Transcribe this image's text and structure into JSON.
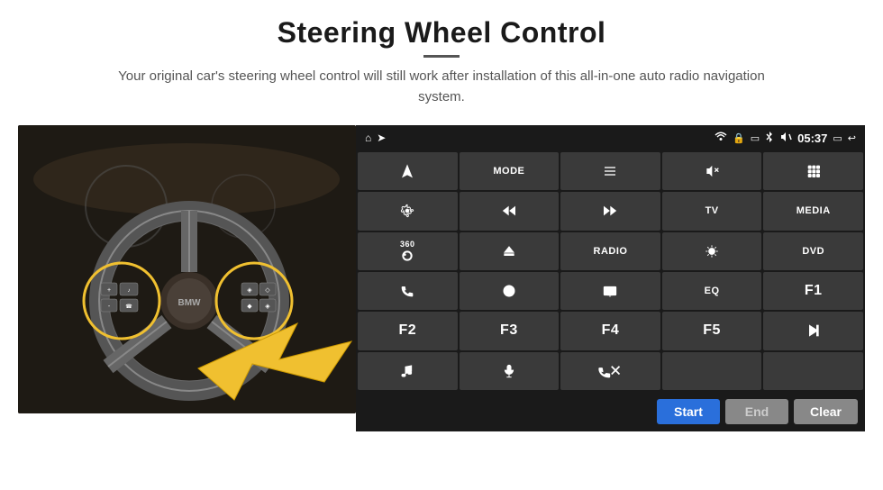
{
  "header": {
    "title": "Steering Wheel Control",
    "subtitle": "Your original car's steering wheel control will still work after installation of this all-in-one auto radio navigation system."
  },
  "statusBar": {
    "time": "05:37",
    "home_icon": "⌂",
    "wifi_icon": "wifi",
    "lock_icon": "🔒",
    "bt_icon": "bt",
    "vol_icon": "🔇",
    "back_icon": "↩",
    "nav_icon": "▤"
  },
  "buttonGrid": [
    {
      "row": 1,
      "buttons": [
        {
          "id": "nav",
          "label": "",
          "icon": "navigate"
        },
        {
          "id": "mode",
          "label": "MODE",
          "icon": ""
        },
        {
          "id": "list",
          "label": "",
          "icon": "list"
        },
        {
          "id": "mute",
          "label": "",
          "icon": "mute"
        },
        {
          "id": "apps",
          "label": "",
          "icon": "apps"
        }
      ]
    },
    {
      "row": 2,
      "buttons": [
        {
          "id": "settings",
          "label": "",
          "icon": "settings"
        },
        {
          "id": "prev",
          "label": "",
          "icon": "prev"
        },
        {
          "id": "next",
          "label": "",
          "icon": "next"
        },
        {
          "id": "tv",
          "label": "TV",
          "icon": ""
        },
        {
          "id": "media",
          "label": "MEDIA",
          "icon": ""
        }
      ]
    },
    {
      "row": 3,
      "buttons": [
        {
          "id": "cam360",
          "label": "360",
          "icon": "360"
        },
        {
          "id": "eject",
          "label": "",
          "icon": "eject"
        },
        {
          "id": "radio",
          "label": "RADIO",
          "icon": ""
        },
        {
          "id": "brightness",
          "label": "",
          "icon": "brightness"
        },
        {
          "id": "dvd",
          "label": "DVD",
          "icon": ""
        }
      ]
    },
    {
      "row": 4,
      "buttons": [
        {
          "id": "phone",
          "label": "",
          "icon": "phone"
        },
        {
          "id": "browser",
          "label": "",
          "icon": "browser"
        },
        {
          "id": "screen",
          "label": "",
          "icon": "screen"
        },
        {
          "id": "eq",
          "label": "EQ",
          "icon": ""
        },
        {
          "id": "f1",
          "label": "F1",
          "icon": ""
        }
      ]
    },
    {
      "row": 5,
      "buttons": [
        {
          "id": "f2",
          "label": "F2",
          "icon": ""
        },
        {
          "id": "f3",
          "label": "F3",
          "icon": ""
        },
        {
          "id": "f4",
          "label": "F4",
          "icon": ""
        },
        {
          "id": "f5",
          "label": "F5",
          "icon": ""
        },
        {
          "id": "playpause",
          "label": "",
          "icon": "playpause"
        }
      ]
    },
    {
      "row": 6,
      "buttons": [
        {
          "id": "music",
          "label": "",
          "icon": "music"
        },
        {
          "id": "mic",
          "label": "",
          "icon": "mic"
        },
        {
          "id": "call",
          "label": "",
          "icon": "call"
        },
        {
          "id": "empty1",
          "label": "",
          "icon": ""
        },
        {
          "id": "empty2",
          "label": "",
          "icon": ""
        }
      ]
    }
  ],
  "actionBar": {
    "start_label": "Start",
    "end_label": "End",
    "clear_label": "Clear"
  }
}
